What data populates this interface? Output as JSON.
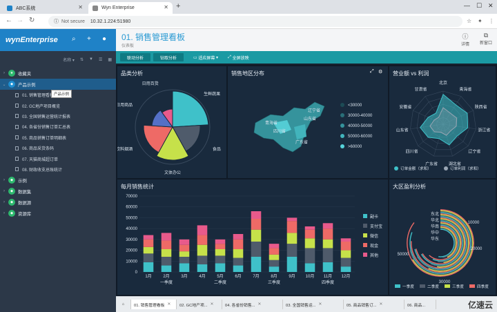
{
  "browser": {
    "tabs": [
      {
        "label": "ABC系统"
      },
      {
        "label": "Wyn Enterprise"
      }
    ],
    "address": {
      "security": "Not secure",
      "url": "10.32.1.224:51980"
    }
  },
  "sidebar": {
    "brand": "wynEnterprise",
    "toolbar": {
      "sort": "名称"
    },
    "items": [
      {
        "label": "收藏夹",
        "color": "#2eb86e"
      },
      {
        "label": "产品示例",
        "color": "#1f8fd1"
      },
      {
        "label": "示例",
        "color": "#2eb86e"
      },
      {
        "label": "数据集",
        "color": "#2eb86e"
      },
      {
        "label": "数据源",
        "color": "#2eb86e"
      },
      {
        "label": "资源库",
        "color": "#2eb86e"
      }
    ],
    "sub_items": [
      {
        "label": "01. 销售管理看板"
      },
      {
        "label": "02. GC地产项目概览"
      },
      {
        "label": "03. 全国销售运营统计报表"
      },
      {
        "label": "04. 各省份销售订单汇总表"
      },
      {
        "label": "05. 商品销售订单明细表"
      },
      {
        "label": "06. 商品采货条码"
      },
      {
        "label": "07. 天猫商城超订单"
      },
      {
        "label": "08. 财政收支总账统计"
      }
    ],
    "tooltip": "产品示例"
  },
  "header": {
    "title": "01. 销售管理看板",
    "subtitle": "仪表板",
    "btn_detail": "详情",
    "btn_new": "新窗口"
  },
  "toolbar": {
    "btn1": "联动分析",
    "btn2": "钻取分析",
    "action1": "适应屏幕",
    "action2": "全屏放映"
  },
  "panels": {
    "pie": "品类分析",
    "map": "销售地区分布",
    "radar": "营业额 vs 利润",
    "bar": "每月销售统计",
    "polar": "大区盈利分析"
  },
  "chart_data": [
    {
      "type": "pie",
      "title": "品类分析",
      "labels": [
        "生鲜蔬果",
        "食品",
        "文体办公",
        "饮料烟酒",
        "日用商品",
        "日用百货"
      ],
      "values": [
        24,
        18,
        16,
        18,
        14,
        10
      ],
      "colors": [
        "#3fc1c9",
        "#4f5b6b",
        "#c6e14a",
        "#ee6a66",
        "#5470c6",
        "#e85a8b"
      ]
    },
    {
      "type": "map",
      "title": "销售地区分布",
      "provinces": [
        "青海省",
        "四川省",
        "山东省",
        "辽宁省",
        "广东省"
      ],
      "legend": [
        "<30000",
        "30000-40000",
        "40000-50000",
        "50000-60000",
        ">60000"
      ],
      "colors": [
        "#1d4b55",
        "#2a6f78",
        "#35939c",
        "#42b4bc",
        "#56d3da"
      ]
    },
    {
      "type": "radar",
      "title": "营业额 vs 利润",
      "axes": [
        "北京",
        "青海省",
        "陕西省",
        "浙江省",
        "辽宁省",
        "湖北省",
        "广东省",
        "四川省",
        "山东省",
        "安徽省",
        "甘肃省"
      ],
      "series": [
        {
          "name": "订单金额（求和）",
          "values": [
            0.9,
            0.7,
            0.8,
            0.75,
            0.55,
            0.65,
            0.45,
            0.6,
            0.7,
            0.5,
            0.4
          ]
        },
        {
          "name": "订单利润（求和）",
          "values": [
            0.5,
            0.4,
            0.45,
            0.4,
            0.3,
            0.35,
            0.25,
            0.35,
            0.4,
            0.3,
            0.25
          ]
        }
      ]
    },
    {
      "type": "bar",
      "title": "每月销售统计",
      "categories": [
        "1月",
        "2月",
        "3月",
        "4月",
        "5月",
        "6月",
        "7月",
        "8月",
        "9月",
        "10月",
        "11月",
        "12月"
      ],
      "groups": [
        "一季度",
        "二季度",
        "三季度",
        "四季度"
      ],
      "ylim": [
        0,
        70000
      ],
      "yticks": [
        0,
        10000,
        20000,
        30000,
        40000,
        50000,
        60000,
        70000
      ],
      "series": [
        {
          "name": "副卡",
          "color": "#3fc1c9",
          "values": [
            9000,
            6000,
            8000,
            7000,
            8000,
            6000,
            14000,
            5000,
            14000,
            8000,
            9000,
            5000
          ]
        },
        {
          "name": "支付宝",
          "color": "#4f5b6b",
          "values": [
            8000,
            8000,
            6000,
            8000,
            7000,
            7000,
            14000,
            6000,
            12000,
            14000,
            13000,
            8000
          ]
        },
        {
          "name": "微信",
          "color": "#c6e14a",
          "values": [
            6000,
            7000,
            5000,
            10000,
            6000,
            8000,
            11000,
            5000,
            10000,
            9000,
            8000,
            7000
          ]
        },
        {
          "name": "现金",
          "color": "#ee6a66",
          "values": [
            7000,
            8000,
            6000,
            9000,
            5000,
            9000,
            10000,
            6000,
            11000,
            8000,
            10000,
            8000
          ]
        },
        {
          "name": "其他",
          "color": "#e85a8b",
          "values": [
            4000,
            7000,
            5000,
            9000,
            4000,
            5000,
            7000,
            4000,
            3000,
            3000,
            5000,
            3000
          ]
        }
      ]
    },
    {
      "type": "polar-bar",
      "title": "大区盈利分析",
      "regions": [
        "华东",
        "华中",
        "华南",
        "华北",
        "东北"
      ],
      "ticks": [
        "10000",
        "20000",
        "30000",
        "50000"
      ],
      "legend": [
        "一季度",
        "二季度",
        "三季度",
        "四季度"
      ],
      "colors": [
        "#3fc1c9",
        "#4f5b6b",
        "#c6e14a",
        "#ee6a66"
      ],
      "values": [
        [
          0.55,
          0.5,
          0.45,
          0.65
        ],
        [
          0.6,
          0.55,
          0.5,
          0.7
        ],
        [
          0.7,
          0.6,
          0.55,
          0.75
        ],
        [
          0.75,
          0.7,
          0.6,
          0.8
        ],
        [
          0.85,
          0.75,
          0.7,
          0.9
        ]
      ]
    }
  ],
  "bottom_tabs": [
    {
      "label": "01. 销售管理看板"
    },
    {
      "label": "02. GC地产项..."
    },
    {
      "label": "04. 各省份销售..."
    },
    {
      "label": "03. 全国销售运..."
    },
    {
      "label": "05. 商品销售订..."
    },
    {
      "label": "06. 商品..."
    }
  ],
  "watermark": "亿速云"
}
